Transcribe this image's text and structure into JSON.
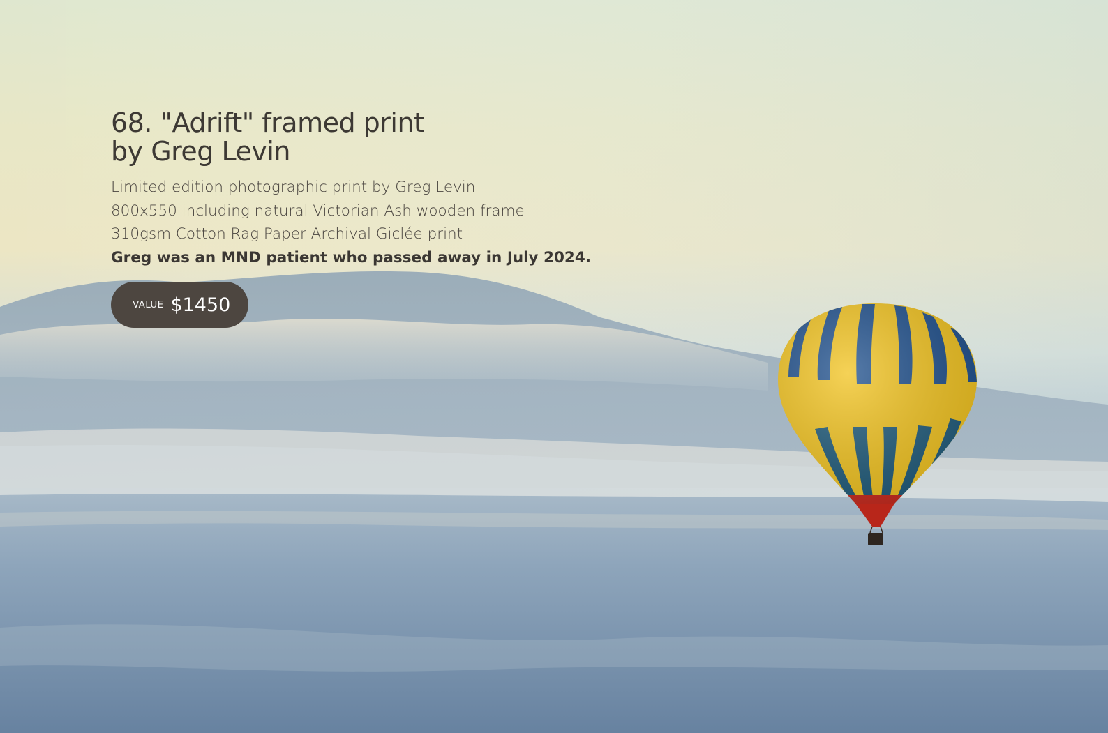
{
  "item": {
    "title_line1": "68. \"Adrift\" framed print",
    "title_line2": "by Greg Levin",
    "description": [
      "Limited edition photographic print by Greg Levin",
      "800x550 including natural Victorian Ash wooden frame",
      "310gsm Cotton Rag Paper Archival Giclée print"
    ],
    "note": "Greg was an MND patient who passed away in July 2024.",
    "value_label": "VALUE",
    "value_amount": "$1450"
  },
  "colors": {
    "text": "#3d3934",
    "pill_background": "#4d4640",
    "pill_text": "#ffffff",
    "balloon_yellow": "#f3c51e",
    "balloon_blue": "#1e4f8c"
  }
}
